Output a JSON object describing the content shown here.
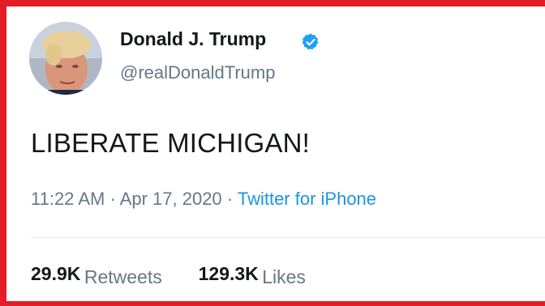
{
  "user": {
    "display_name": "Donald J. Trump",
    "handle": "@realDonaldTrump",
    "verified_icon": "verified-badge-icon"
  },
  "tweet": {
    "text": "LIBERATE MICHIGAN!",
    "time": "11:22 AM",
    "separator": "·",
    "date": "Apr 17, 2020",
    "source": "Twitter for iPhone"
  },
  "stats": {
    "retweets_count": "29.9K",
    "retweets_label": "Retweets",
    "likes_count": "129.3K",
    "likes_label": "Likes"
  },
  "colors": {
    "frame": "#e41e26",
    "link": "#1b95e0",
    "secondary_text": "#657786",
    "primary_text": "#14171a",
    "verified": "#1da1f2"
  }
}
